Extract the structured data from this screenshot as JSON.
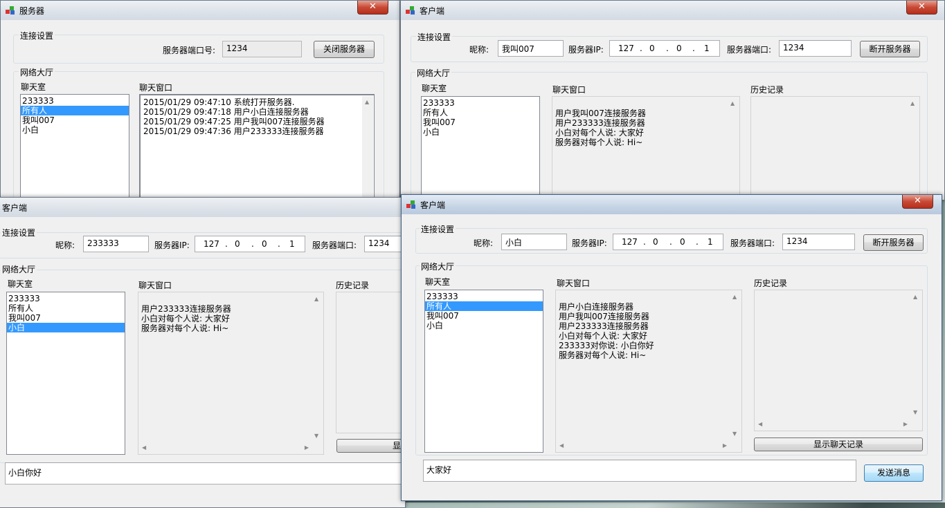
{
  "server": {
    "title": "服务器",
    "conn_group": "连接设置",
    "port_label": "服务器端口号:",
    "port_value": "1234",
    "close_button": "关闭服务器",
    "lobby_group": "网络大厅",
    "room_label": "聊天室",
    "users": [
      "233333",
      "所有人",
      "我叫007",
      "小白"
    ],
    "selected_user": "所有人",
    "chat_label": "聊天窗口",
    "log": [
      "2015/01/29 09:47:10  系统打开服务器.",
      "2015/01/29 09:47:18  用户小白连接服务器",
      "2015/01/29 09:47:25  用户我叫007连接服务器",
      "2015/01/29 09:47:36  用户233333连接服务器"
    ]
  },
  "client007": {
    "title": "客户端",
    "conn_group": "连接设置",
    "nick_label": "昵称:",
    "nick_value": "我叫007",
    "ip_label": "服务器IP:",
    "ip": [
      "127",
      "0",
      "0",
      "1"
    ],
    "port_label": "服务器端口:",
    "port_value": "1234",
    "disconnect_button": "断开服务器",
    "lobby_group": "网络大厅",
    "room_label": "聊天室",
    "users": [
      "233333",
      "所有人",
      "我叫007",
      "小白"
    ],
    "chat_label": "聊天窗口",
    "history_label": "历史记录",
    "messages": [
      "用户我叫007连接服务器",
      "用户233333连接服务器",
      "小白对每个人说: 大家好",
      "服务器对每个人说: Hi~"
    ]
  },
  "client233333": {
    "title": "客户端",
    "conn_group": "连接设置",
    "nick_label": "昵称:",
    "nick_value": "233333",
    "ip_label": "服务器IP:",
    "ip": [
      "127",
      "0",
      "0",
      "1"
    ],
    "port_label": "服务器端口:",
    "port_value": "1234",
    "lobby_group": "网络大厅",
    "room_label": "聊天室",
    "users": [
      "233333",
      "所有人",
      "我叫007",
      "小白"
    ],
    "selected_user": "小白",
    "chat_label": "聊天窗口",
    "history_label": "历史记录",
    "messages": [
      "用户233333连接服务器",
      "小白对每个人说: 大家好",
      "服务器对每个人说: Hi~"
    ],
    "show_history_button_partial": "显",
    "input_value": "小白你好"
  },
  "clientXiaobai": {
    "title": "客户端",
    "conn_group": "连接设置",
    "nick_label": "昵称:",
    "nick_value": "小白",
    "ip_label": "服务器IP:",
    "ip": [
      "127",
      "0",
      "0",
      "1"
    ],
    "port_label": "服务器端口:",
    "port_value": "1234",
    "disconnect_button": "断开服务器",
    "lobby_group": "网络大厅",
    "room_label": "聊天室",
    "users": [
      "233333",
      "所有人",
      "我叫007",
      "小白"
    ],
    "selected_user": "所有人",
    "chat_label": "聊天窗口",
    "history_label": "历史记录",
    "messages": [
      "用户小白连接服务器",
      "用户我叫007连接服务器",
      "用户233333连接服务器",
      "小白对每个人说: 大家好",
      "233333对你说:  小白你好",
      "服务器对每个人说: Hi~"
    ],
    "show_history_button": "显示聊天记录",
    "input_value": "大家好",
    "send_button": "发送消息"
  },
  "close_glyph": "✕",
  "colors": {
    "selection": "#3399ff",
    "close_button": "#c84a36",
    "window_bg": "#f0f0f0"
  },
  "icons": {
    "app": "app-icon",
    "close": "close-icon"
  }
}
